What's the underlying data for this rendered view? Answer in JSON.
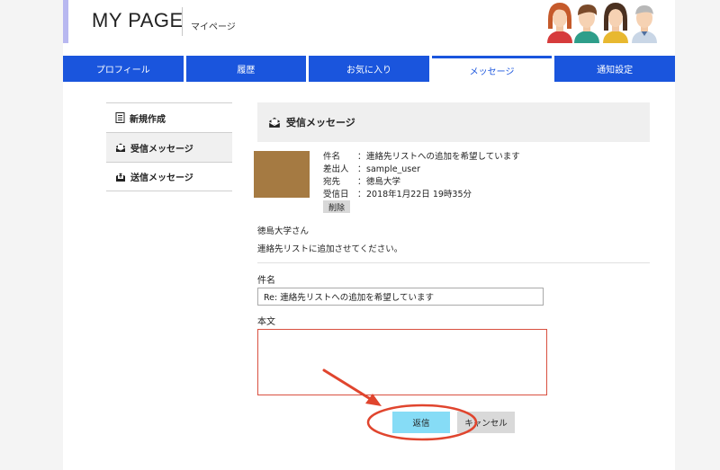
{
  "header": {
    "title": "MY PAGE",
    "subtitle": "マイページ"
  },
  "nav": {
    "tabs": [
      {
        "label": "プロフィール"
      },
      {
        "label": "履歴"
      },
      {
        "label": "お気に入り"
      },
      {
        "label": "メッセージ",
        "active": true
      },
      {
        "label": "通知設定"
      }
    ]
  },
  "sidebar": {
    "items": [
      {
        "label": "新規作成",
        "icon": "document-icon"
      },
      {
        "label": "受信メッセージ",
        "icon": "inbox-icon",
        "active": true
      },
      {
        "label": "送信メッセージ",
        "icon": "outbox-icon"
      }
    ]
  },
  "main": {
    "section_title": "受信メッセージ",
    "message": {
      "subject_key": "件名",
      "subject": "連絡先リストへの追加を希望しています",
      "sender_key": "差出人",
      "sender": "sample_user",
      "to_key": "宛先",
      "to": "徳島大学",
      "received_key": "受信日",
      "received": "2018年1月22日 19時35分",
      "delete_label": "削除",
      "greeting": "徳島大学さん",
      "body": "連絡先リストに追加させてください。"
    },
    "reply_form": {
      "subject_label": "件名",
      "subject_value": "Re: 連絡先リストへの追加を希望しています",
      "body_label": "本文",
      "body_value": "",
      "send_label": "返信",
      "cancel_label": "キャンセル"
    }
  },
  "colors": {
    "nav_blue": "#1a55dd",
    "reply_button": "#86dcf6",
    "annotation_red": "#e0452e"
  }
}
